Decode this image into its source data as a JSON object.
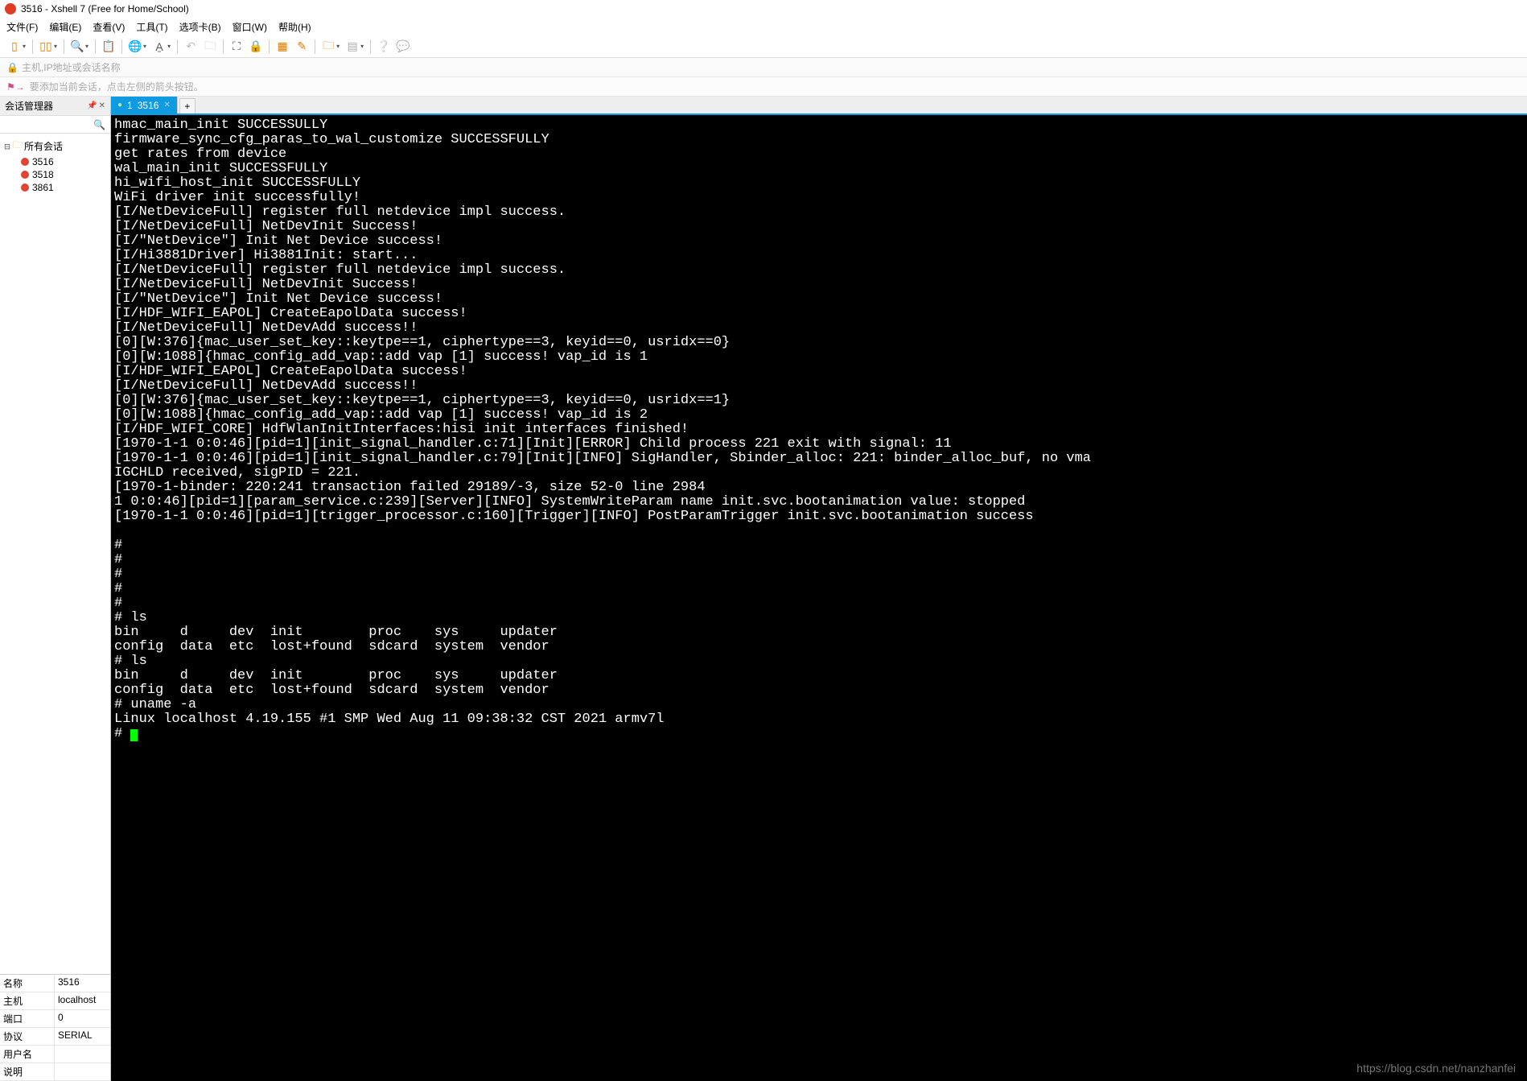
{
  "window": {
    "title": "3516 - Xshell 7 (Free for Home/School)"
  },
  "menu": {
    "file": "文件(F)",
    "edit": "编辑(E)",
    "view": "查看(V)",
    "tools": "工具(T)",
    "tabs": "选项卡(B)",
    "window": "窗口(W)",
    "help": "帮助(H)"
  },
  "address": {
    "placeholder": "主机,IP地址或会话名称"
  },
  "hint": {
    "text": "要添加当前会话，点击左侧的箭头按钮。"
  },
  "sidebar": {
    "title": "会话管理器",
    "root": "所有会话",
    "items": [
      {
        "label": "3516"
      },
      {
        "label": "3518"
      },
      {
        "label": "3861"
      }
    ]
  },
  "tabs": {
    "active_prefix": "1",
    "active_label": "3516",
    "add": "+"
  },
  "props": {
    "rows": [
      {
        "k": "名称",
        "v": "3516"
      },
      {
        "k": "主机",
        "v": "localhost"
      },
      {
        "k": "端口",
        "v": "0"
      },
      {
        "k": "协议",
        "v": "SERIAL"
      },
      {
        "k": "用户名",
        "v": ""
      },
      {
        "k": "说明",
        "v": ""
      }
    ]
  },
  "terminal": {
    "lines": "hmac_main_init SUCCESSULLY\nfirmware_sync_cfg_paras_to_wal_customize SUCCESSFULLY\nget rates from device\nwal_main_init SUCCESSFULLY\nhi_wifi_host_init SUCCESSFULLY\nWiFi driver init successfully!\n[I/NetDeviceFull] register full netdevice impl success.\n[I/NetDeviceFull] NetDevInit Success!\n[I/\"NetDevice\"] Init Net Device success!\n[I/Hi3881Driver] Hi3881Init: start...\n[I/NetDeviceFull] register full netdevice impl success.\n[I/NetDeviceFull] NetDevInit Success!\n[I/\"NetDevice\"] Init Net Device success!\n[I/HDF_WIFI_EAPOL] CreateEapolData success!\n[I/NetDeviceFull] NetDevAdd success!!\n[0][W:376]{mac_user_set_key::keytpe==1, ciphertype==3, keyid==0, usridx==0}\n[0][W:1088]{hmac_config_add_vap::add vap [1] success! vap_id is 1\n[I/HDF_WIFI_EAPOL] CreateEapolData success!\n[I/NetDeviceFull] NetDevAdd success!!\n[0][W:376]{mac_user_set_key::keytpe==1, ciphertype==3, keyid==0, usridx==1}\n[0][W:1088]{hmac_config_add_vap::add vap [1] success! vap_id is 2\n[I/HDF_WIFI_CORE] HdfWlanInitInterfaces:hisi init interfaces finished!\n[1970-1-1 0:0:46][pid=1][init_signal_handler.c:71][Init][ERROR] Child process 221 exit with signal: 11\n[1970-1-1 0:0:46][pid=1][init_signal_handler.c:79][Init][INFO] SigHandler, Sbinder_alloc: 221: binder_alloc_buf, no vma\nIGCHLD received, sigPID = 221.\n[1970-1-binder: 220:241 transaction failed 29189/-3, size 52-0 line 2984\n1 0:0:46][pid=1][param_service.c:239][Server][INFO] SystemWriteParam name init.svc.bootanimation value: stopped\n[1970-1-1 0:0:46][pid=1][trigger_processor.c:160][Trigger][INFO] PostParamTrigger init.svc.bootanimation success\n\n#\n#\n#\n#\n#\n# ls\nbin     d     dev  init        proc    sys     updater\nconfig  data  etc  lost+found  sdcard  system  vendor\n# ls\nbin     d     dev  init        proc    sys     updater\nconfig  data  etc  lost+found  sdcard  system  vendor\n# uname -a\nLinux localhost 4.19.155 #1 SMP Wed Aug 11 09:38:32 CST 2021 armv7l\n# "
  },
  "watermark": "https://blog.csdn.net/nanzhanfei"
}
